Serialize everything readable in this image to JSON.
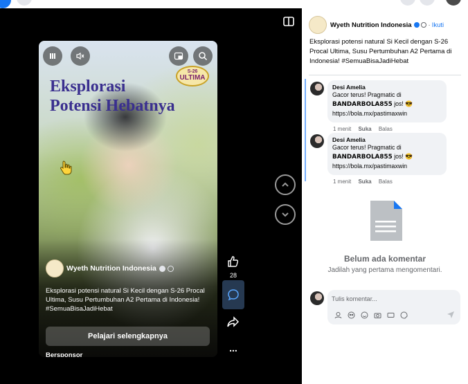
{
  "colors": {
    "accent": "#1877f2",
    "stage_bg": "#000000",
    "headline": "#3a2f8f",
    "active_rail": "#263951",
    "muted_text": "#65676b"
  },
  "video": {
    "badge_small": "S-26",
    "badge_big": "ULTIMA",
    "headline_line1": "Eksplorasi",
    "headline_line2": "Potensi Hebatnya",
    "page_name": "Wyeth Nutrition Indonesia",
    "caption": "Eksplorasi potensi natural Si Kecil dengan S-26 Procal Ultima, Susu Pertumbuhan A2 Pertama di Indonesia! #SemuaBisaJadiHebat",
    "cta_label": "Pelajari selengkapnya",
    "sponsored_label": "Bersponsor",
    "controls": [
      "pause-icon",
      "mute-icon",
      "picture-in-picture-icon",
      "search-icon"
    ]
  },
  "rail": {
    "like_count": "28",
    "more_label": "..."
  },
  "panel": {
    "page_name": "Wyeth Nutrition Indonesia",
    "separator": "·",
    "follow_label": "Ikuti",
    "post_text": "Eksplorasi potensi natural Si Kecil dengan S-26 Procal Ultima, Susu Pertumbuhan A2 Pertama di Indonesia! #SemuaBisaJadiHebat",
    "comments": [
      {
        "author": "Desi Amelia",
        "text_before": "Gacor terus! Pragmatic di",
        "text_bold": "BANDARBOLA855",
        "text_after": "jos! 😎",
        "link": "https://bola.mx/pastimaxwin",
        "time": "1 menit",
        "like_label": "Suka",
        "reply_label": "Balas"
      },
      {
        "author": "Desi Amelia",
        "text_before": "Gacor terus! Pragmatic di",
        "text_bold": "BANDARBOLA855",
        "text_after": "jos! 😎",
        "link": "https://bola.mx/pastimaxwin",
        "time": "1 menit",
        "like_label": "Suka",
        "reply_label": "Balas"
      }
    ],
    "empty_title": "Belum ada komentar",
    "empty_subtitle": "Jadilah yang pertama mengomentari.",
    "composer_placeholder": "Tulis komentar...",
    "composer_tools": [
      "avatar-sticker-icon",
      "gif-icon",
      "emoji-icon",
      "camera-icon",
      "gif-alt-icon",
      "sticker-icon"
    ]
  }
}
